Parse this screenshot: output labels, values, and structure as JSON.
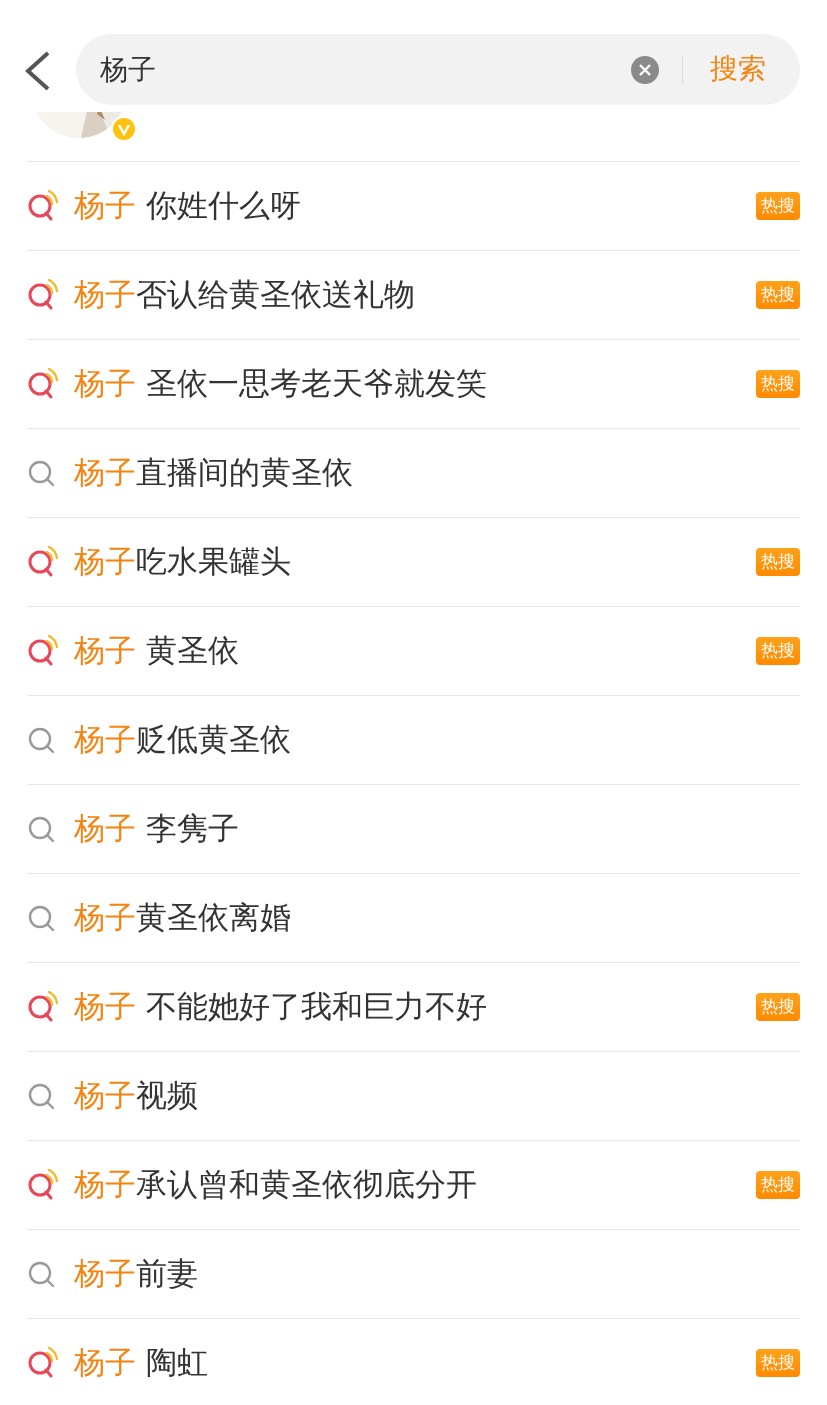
{
  "search": {
    "value": "杨子",
    "button": "搜索"
  },
  "profile": {
    "verified": true
  },
  "suggestions": [
    {
      "keyword": "杨子",
      "rest": " 你姓什么呀",
      "hot": true,
      "badge": "热搜"
    },
    {
      "keyword": "杨子",
      "rest": "否认给黄圣依送礼物",
      "hot": true,
      "badge": "热搜"
    },
    {
      "keyword": "杨子",
      "rest": " 圣依一思考老天爷就发笑",
      "hot": true,
      "badge": "热搜"
    },
    {
      "keyword": "杨子",
      "rest": "直播间的黄圣依",
      "hot": false
    },
    {
      "keyword": "杨子",
      "rest": "吃水果罐头",
      "hot": true,
      "badge": "热搜"
    },
    {
      "keyword": "杨子",
      "rest": " 黄圣依",
      "hot": true,
      "badge": "热搜"
    },
    {
      "keyword": "杨子",
      "rest": "贬低黄圣依",
      "hot": false
    },
    {
      "keyword": "杨子",
      "rest": " 李隽子",
      "hot": false
    },
    {
      "keyword": "杨子",
      "rest": "黄圣依离婚",
      "hot": false
    },
    {
      "keyword": "杨子",
      "rest": " 不能她好了我和巨力不好",
      "hot": true,
      "badge": "热搜"
    },
    {
      "keyword": "杨子",
      "rest": "视频",
      "hot": false
    },
    {
      "keyword": "杨子",
      "rest": "承认曾和黄圣依彻底分开",
      "hot": true,
      "badge": "热搜"
    },
    {
      "keyword": "杨子",
      "rest": "前妻",
      "hot": false
    },
    {
      "keyword": "杨子",
      "rest": " 陶虹",
      "hot": true,
      "badge": "热搜"
    }
  ]
}
